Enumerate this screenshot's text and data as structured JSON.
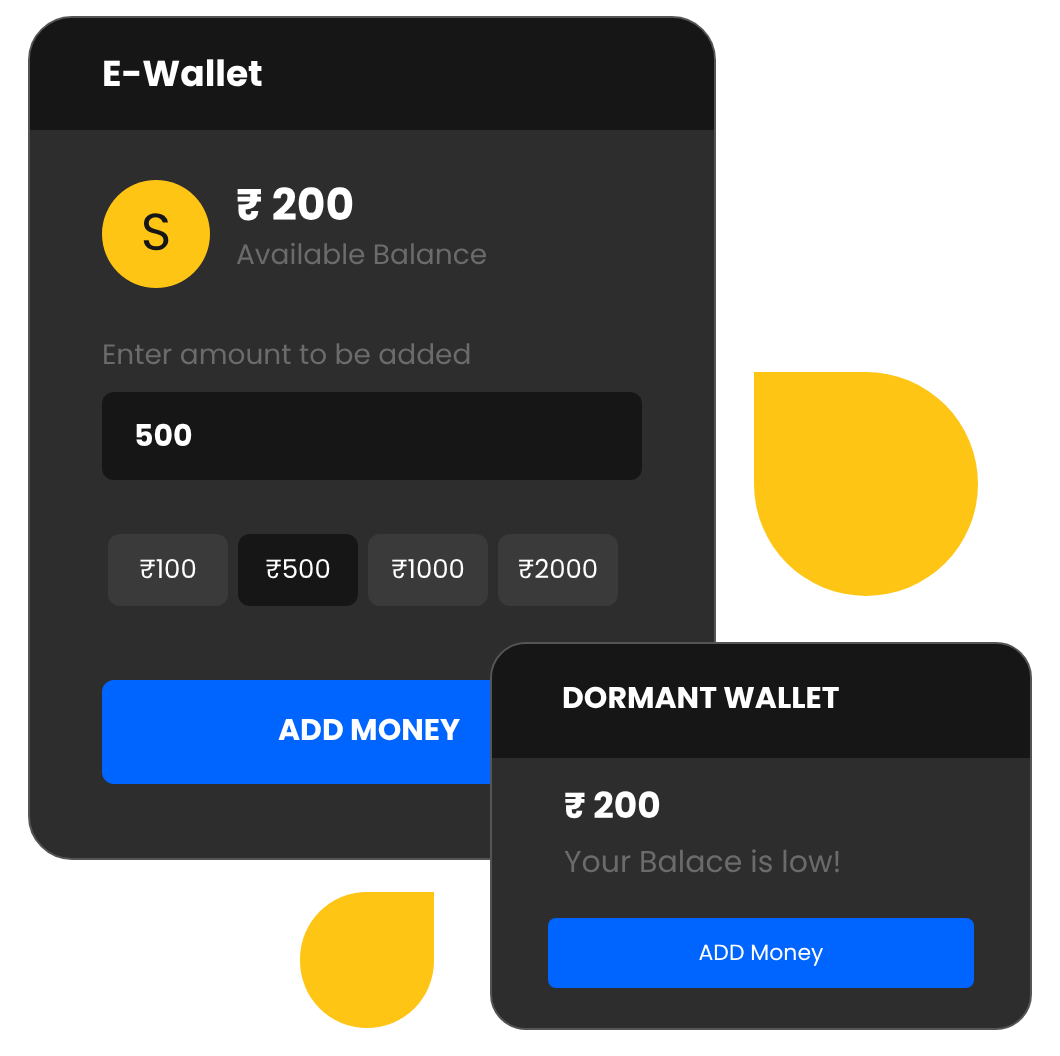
{
  "wallet": {
    "title": "E-Wallet",
    "avatar_letter": "S",
    "balance": "₹ 200",
    "balance_label": "Available Balance",
    "amount_label": "Enter amount to be added",
    "amount_value": "500",
    "chips": [
      {
        "label": "₹100",
        "selected": false
      },
      {
        "label": "₹500",
        "selected": true
      },
      {
        "label": "₹1000",
        "selected": false
      },
      {
        "label": "₹2000",
        "selected": false
      }
    ],
    "button": "ADD MONEY"
  },
  "dormant_wallet": {
    "title": "DORMANT WALLET",
    "balance": "₹ 200",
    "message": "Your Balace is low!",
    "button": "ADD Money"
  }
}
